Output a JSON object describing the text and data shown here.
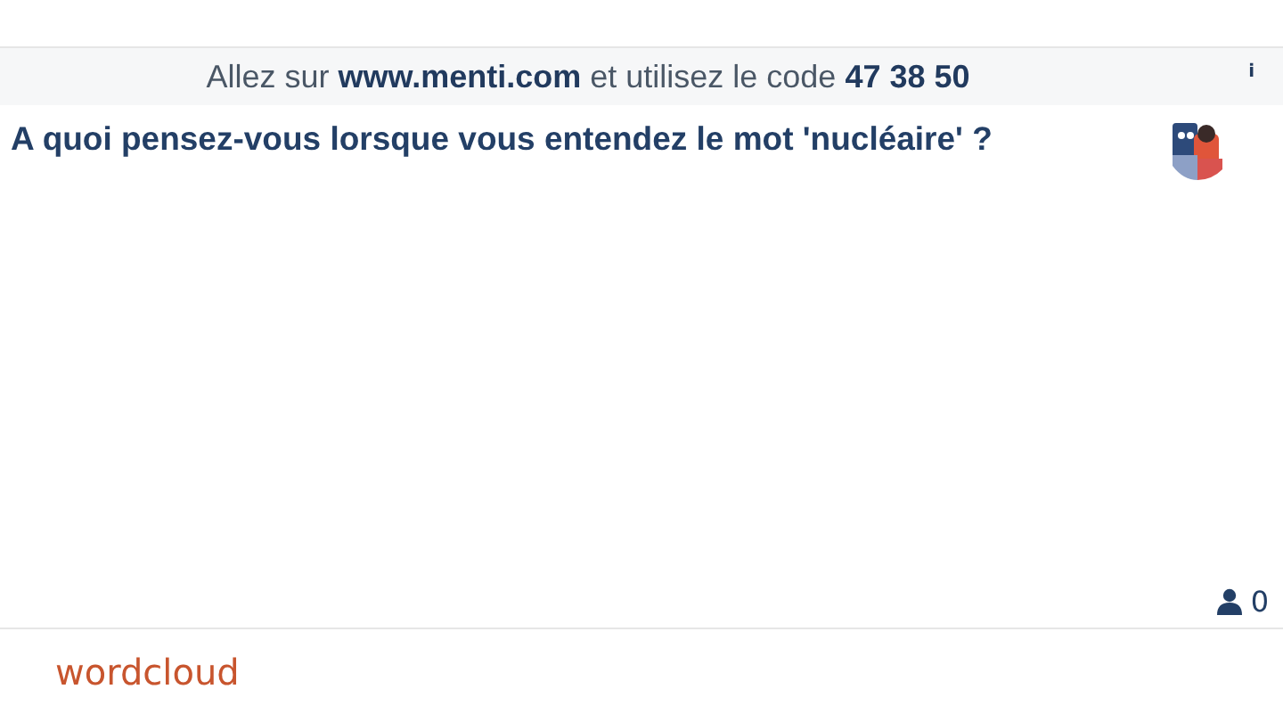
{
  "banner": {
    "text": "Allez sur **www.menti.com** et utilisez le code **47 38 50**",
    "info": "i"
  },
  "question": "A quoi pensez-vous lorsque vous entendez le mot 'nucléaire' ?",
  "participants": {
    "count": "0"
  },
  "caption": "wordcloud"
}
